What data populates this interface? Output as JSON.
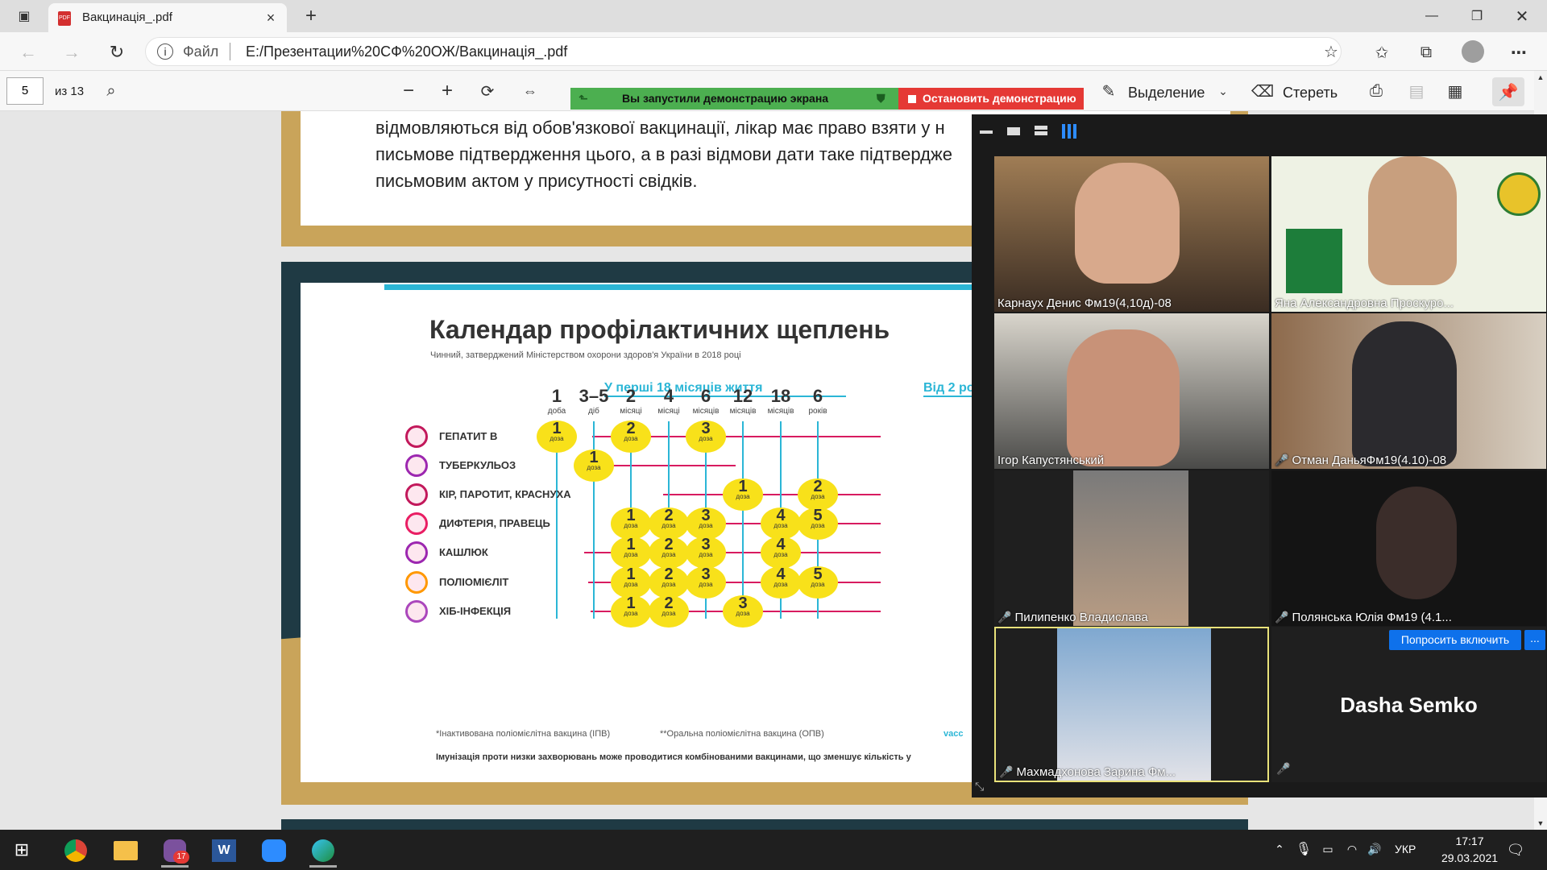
{
  "browser": {
    "tab_title": "Вакцинація_.pdf",
    "address_label": "Файл",
    "url": "E:/Презентации%20СФ%20ОЖ/Вакцинація_.pdf"
  },
  "pdf_toolbar": {
    "page_value": "5",
    "page_total": "из 13",
    "highlight_label": "Выделение",
    "erase_label": "Стереть"
  },
  "share_bar": {
    "status": "Вы запустили демонстрацию экрана",
    "stop": "Остановить демонстрацию"
  },
  "slide_text": [
    "відмовляються від обов'язкової вакцинації, лікар має право взяти у н",
    "письмове підтвердження цього, а в разі відмови дати таке підтвердже",
    "письмовим актом у присутності свідків."
  ],
  "calendar": {
    "title": "Календар профілактичних щеплень",
    "subtitle": "Чинний, затверджений Міністерством охорони здоров'я України в 2018 році",
    "range1": "У перші 18 місяців життя",
    "range2": "Від 2 ро",
    "ages": [
      [
        "1",
        "доба"
      ],
      [
        "3–5",
        "діб"
      ],
      [
        "2",
        "місяці"
      ],
      [
        "4",
        "місяці"
      ],
      [
        "6",
        "місяців"
      ],
      [
        "12",
        "місяців"
      ],
      [
        "18",
        "місяців"
      ],
      [
        "6",
        "років"
      ]
    ],
    "diseases": [
      "ГЕПАТИТ В",
      "ТУБЕРКУЛЬОЗ",
      "КІР, ПАРОТИТ, КРАСНУХА",
      "ДИФТЕРІЯ, ПРАВЕЦЬ",
      "КАШЛЮК",
      "ПОЛІОМІЄЛІТ",
      "ХІБ-ІНФЕКЦІЯ"
    ],
    "dose_word": "доза",
    "note1": "*Інактивована поліомієлітна вакцина (ІПВ)",
    "note2": "**Оральна поліомієлітна вакцина (ОПВ)",
    "note3": "vacc",
    "footer": "Імунізація проти низки захворювань може проводитися комбінованими вакцинами, що зменшує кількість у"
  },
  "zoom": {
    "participants": [
      "Карнаух Денис Фм19(4,10д)-08",
      "Яна Александровна Проскуро...",
      "Ігор Капустянський",
      "Отман ДаньяФм19(4.10)-08",
      "Пилипенко Владислава",
      "Полянська Юлія Фм19 (4.1...",
      "Махмадхонова Зарина Фм...",
      "Dasha Semko"
    ],
    "ask_button": "Попросить включить",
    "more": "..."
  },
  "taskbar": {
    "lang": "УКР",
    "time": "17:17",
    "date": "29.03.2021",
    "viber_badge": "17"
  }
}
